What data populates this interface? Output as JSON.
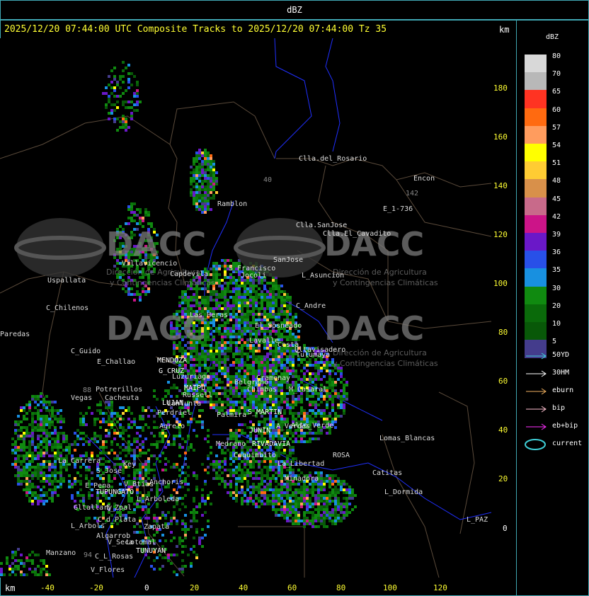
{
  "window": {
    "title": "dBZ"
  },
  "header": {
    "product_line": "2025/12/20 07:44:00 UTC Composite Tracks to 2025/12/20 07:44:00 Tz 35",
    "km_label_top": "km",
    "km_label_bottom": "km"
  },
  "axes": {
    "x_ticks": [
      "-40",
      "-20",
      "0",
      "20",
      "40",
      "60",
      "80",
      "100",
      "120"
    ],
    "y_ticks": [
      "180",
      "160",
      "140",
      "120",
      "100",
      "80",
      "60",
      "40",
      "20",
      "0"
    ]
  },
  "legend": {
    "title": "dBZ",
    "scale": [
      {
        "label": "80",
        "color": "#d8d8d8"
      },
      {
        "label": "70",
        "color": "#b8b8b8"
      },
      {
        "label": "65",
        "color": "#ff3322"
      },
      {
        "label": "60",
        "color": "#ff6a10"
      },
      {
        "label": "57",
        "color": "#ff9c5e"
      },
      {
        "label": "54",
        "color": "#ffff00"
      },
      {
        "label": "51",
        "color": "#ffcc33"
      },
      {
        "label": "48",
        "color": "#d8904a"
      },
      {
        "label": "45",
        "color": "#c86a8a"
      },
      {
        "label": "42",
        "color": "#cc1488"
      },
      {
        "label": "39",
        "color": "#6a18c8"
      },
      {
        "label": "36",
        "color": "#2850e8"
      },
      {
        "label": "35",
        "color": "#1890e0"
      },
      {
        "label": "30",
        "color": "#108a10"
      },
      {
        "label": "20",
        "color": "#0a6a0a"
      },
      {
        "label": "10",
        "color": "#085808"
      },
      {
        "label": "5",
        "color": "#443c8c"
      }
    ],
    "tracks": [
      {
        "label": "50YD",
        "color": "#40d0d8"
      },
      {
        "label": "30HM",
        "color": "#ffffff"
      },
      {
        "label": "eburn",
        "color": "#f0b060"
      },
      {
        "label": "bip",
        "color": "#ffc0d0"
      },
      {
        "label": "eb+bip",
        "color": "#ff30ff"
      },
      {
        "label": "current",
        "color": "#40d0d8"
      }
    ]
  },
  "watermark": {
    "brand": "DACC",
    "line1": "Dirección de Agricultura",
    "line2": "y Contingencias Climáticas"
  },
  "places": [
    {
      "name": "Clla.del_Rosario"
    },
    {
      "name": "Encon"
    },
    {
      "name": "E_1-736"
    },
    {
      "name": "142"
    },
    {
      "name": "Ramblon"
    },
    {
      "name": "Clla.SanJose"
    },
    {
      "name": "Clla.El_Cavadito"
    },
    {
      "name": "Villavicencio"
    },
    {
      "name": "Uspallata"
    },
    {
      "name": "Capdevila"
    },
    {
      "name": "S_Francisco"
    },
    {
      "name": "Jocoli"
    },
    {
      "name": "SanJose"
    },
    {
      "name": "L_Asuncion"
    },
    {
      "name": "C_Chilenos"
    },
    {
      "name": "Paredas"
    },
    {
      "name": "C_Andre"
    },
    {
      "name": "Las_Heras"
    },
    {
      "name": "El_Sosneado"
    },
    {
      "name": "Lavalle"
    },
    {
      "name": "Costa"
    },
    {
      "name": "Tulumaya"
    },
    {
      "name": "Ultavisadero"
    },
    {
      "name": "C_Guido"
    },
    {
      "name": "E_Challao"
    },
    {
      "name": "MENDOZA"
    },
    {
      "name": "G_CRUZ"
    },
    {
      "name": "Luzuriaga"
    },
    {
      "name": "Belgrano"
    },
    {
      "name": "Chimbas"
    },
    {
      "name": "Cramenay"
    },
    {
      "name": "M_Casaral"
    },
    {
      "name": "Potrerillos"
    },
    {
      "name": "Cacheuta"
    },
    {
      "name": "Vegas"
    },
    {
      "name": "88"
    },
    {
      "name": "MAIPU"
    },
    {
      "name": "Russell"
    },
    {
      "name": "LUJAN"
    },
    {
      "name": "Lunlunta"
    },
    {
      "name": "Perdriel"
    },
    {
      "name": "Palmira"
    },
    {
      "name": "S_MARTIN"
    },
    {
      "name": "Agrelo"
    },
    {
      "name": "JUNIN"
    },
    {
      "name": "Alto_Verde"
    },
    {
      "name": "A_Verdes"
    },
    {
      "name": "Medrano"
    },
    {
      "name": "RIVADAVIA"
    },
    {
      "name": "Lomas_Blancas"
    },
    {
      "name": "La_Carrera"
    },
    {
      "name": "Key"
    },
    {
      "name": "S_Jose"
    },
    {
      "name": "La_Libertad"
    },
    {
      "name": "Coquimbito"
    },
    {
      "name": "ROSA"
    },
    {
      "name": "Catitas"
    },
    {
      "name": "Anchoris"
    },
    {
      "name": "Minadora"
    },
    {
      "name": "E_Pena"
    },
    {
      "name": "V_Btias"
    },
    {
      "name": "TUPUNGATO"
    },
    {
      "name": "L_Arboleda"
    },
    {
      "name": "L_Dormida"
    },
    {
      "name": "Gltallary"
    },
    {
      "name": "E_Zpal"
    },
    {
      "name": "C_d_Plata"
    },
    {
      "name": "L_Arbols"
    },
    {
      "name": "Zapata"
    },
    {
      "name": "L_PAZ"
    },
    {
      "name": "Algarrob"
    },
    {
      "name": "V_Seca"
    },
    {
      "name": "Lotomal"
    },
    {
      "name": "TUNUYAN"
    },
    {
      "name": "Manzano"
    },
    {
      "name": "C_L_Rosas"
    },
    {
      "name": "V_Flores"
    },
    {
      "name": "94"
    },
    {
      "name": "40"
    }
  ]
}
